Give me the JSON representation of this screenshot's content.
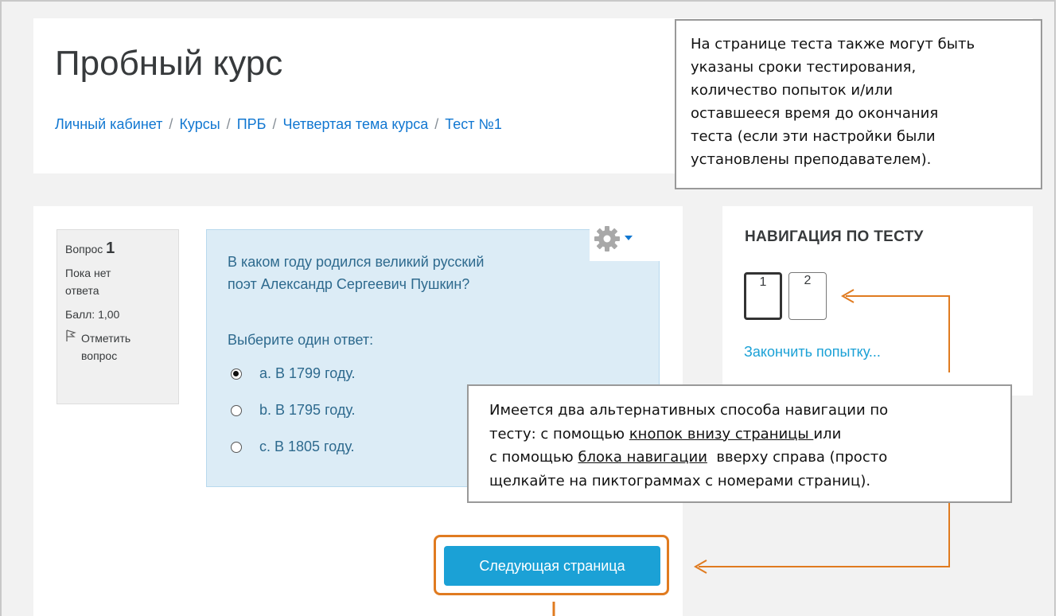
{
  "page": {
    "title": "Пробный курс",
    "breadcrumb": [
      "Личный кабинет",
      "Курсы",
      "ПРБ",
      "Четвертая тема курса",
      "Тест №1"
    ],
    "breadcrumb_separator": "/"
  },
  "question_info": {
    "label": "Вопрос",
    "number": "1",
    "status_line1": "Пока нет",
    "status_line2": "ответа",
    "score": "Балл: 1,00",
    "flag_line1": "Отметить",
    "flag_line2": "вопрос",
    "flag_icon": "flag-icon"
  },
  "question": {
    "text_line1": "В каком году родился великий русский",
    "text_line2": "поэт Александр Сергеевич Пушкин?",
    "prompt": "Выберите один ответ:",
    "answers": [
      {
        "label": "a. В 1799 году.",
        "selected": true
      },
      {
        "label": "b. В 1795 году.",
        "selected": false
      },
      {
        "label": "c. В 1805 году.",
        "selected": false
      }
    ],
    "settings_icon": "gear-icon"
  },
  "navigation": {
    "title": "НАВИГАЦИЯ ПО ТЕСТУ",
    "pages": [
      "1",
      "2"
    ],
    "current_page": "1",
    "finish_link": "Закончить попытку..."
  },
  "buttons": {
    "next_page": "Следующая страница"
  },
  "callouts": {
    "top": [
      "На странице теста также могут быть",
      "указаны сроки тестирования,",
      "количество попыток и/или",
      "оставшееся время до окончания",
      "теста  (если эти настройки были",
      "установлены преподавателем)."
    ],
    "bottom": {
      "line1": "Имеется два альтернативных способа навигации по",
      "line2_prefix": "тесту: с помощью ",
      "line2_link": "кнопок внизу  страницы ",
      "line2_suffix": "или",
      "line3_prefix": "с помощью ",
      "line3_link": "блока навигации",
      "line3_suffix": "  вверху справа (просто",
      "line4": "щелкайте на пиктограммах с номерами страниц)."
    }
  },
  "colors": {
    "link": "#1177d1",
    "accent_button": "#1ba1d6",
    "question_bg": "#dcecf6",
    "annotation_orange": "#e07b20"
  }
}
